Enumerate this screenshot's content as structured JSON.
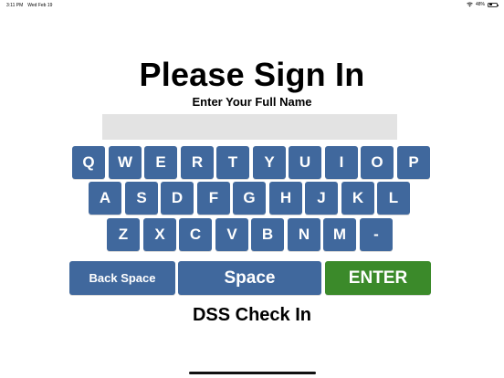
{
  "status_bar": {
    "time": "3:11 PM",
    "date": "Wed Feb 19",
    "battery": "48%",
    "battery_level": 0.48,
    "wifi_icon": "wifi-icon",
    "battery_icon": "battery-icon"
  },
  "title": "Please Sign In",
  "subtitle": "Enter Your Full Name",
  "name_input": {
    "value": "",
    "placeholder": ""
  },
  "keyboard": {
    "rows": [
      [
        "Q",
        "W",
        "E",
        "R",
        "T",
        "Y",
        "U",
        "I",
        "O",
        "P"
      ],
      [
        "A",
        "S",
        "D",
        "F",
        "G",
        "H",
        "J",
        "K",
        "L"
      ],
      [
        "Z",
        "X",
        "C",
        "V",
        "B",
        "N",
        "M",
        "-"
      ]
    ],
    "backspace_label": "Back Space",
    "space_label": "Space",
    "enter_label": "ENTER"
  },
  "colors": {
    "key_blue": "#40689d",
    "enter_green": "#3b8a2a",
    "input_gray": "#e3e3e3"
  },
  "footer": "DSS Check In"
}
